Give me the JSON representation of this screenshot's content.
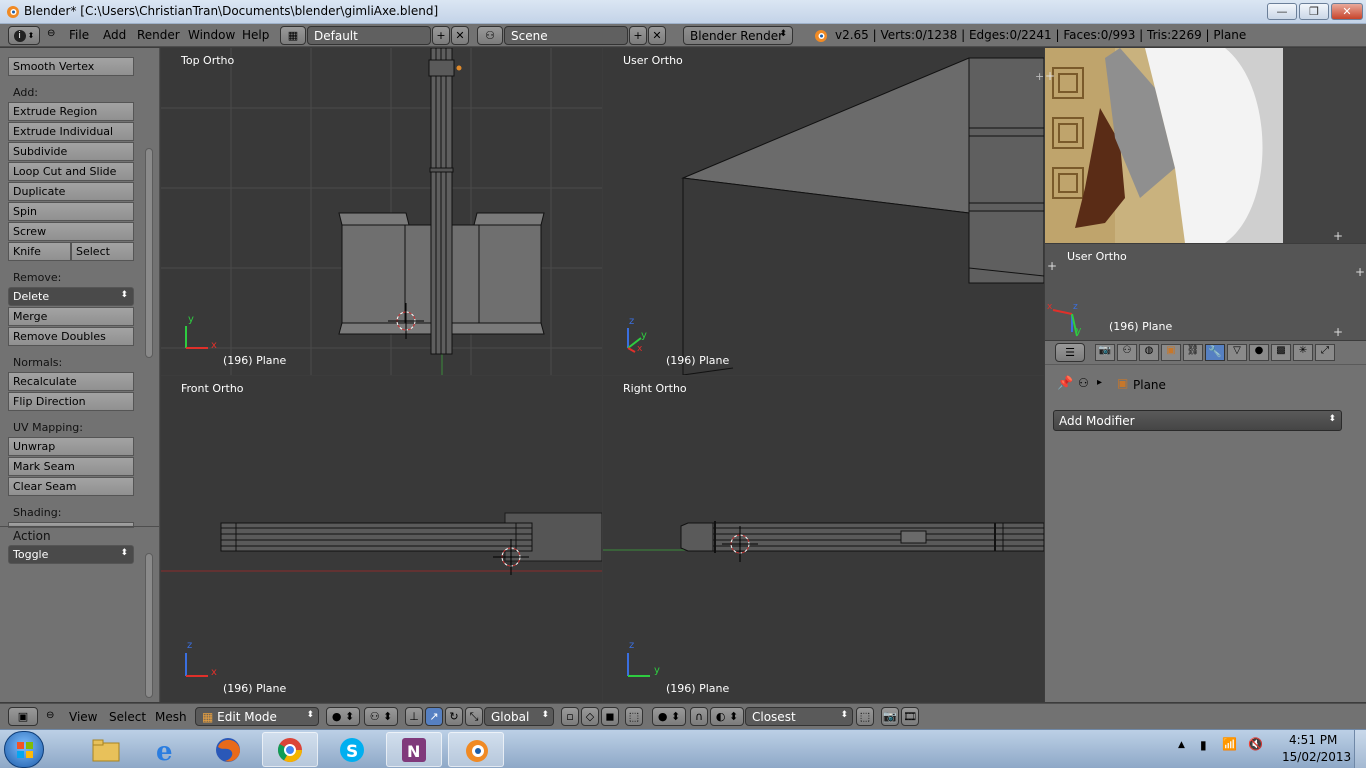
{
  "window": {
    "title": "Blender* [C:\\Users\\ChristianTran\\Documents\\blender\\gimliAxe.blend]",
    "minimize": "—",
    "maximize": "❐",
    "close": "✕"
  },
  "info_header": {
    "menus": [
      "File",
      "Add",
      "Render",
      "Window",
      "Help"
    ],
    "screen_layout": "Default",
    "scene": "Scene",
    "render_engine": "Blender Render",
    "stats": "v2.65 | Verts:0/1238 | Edges:0/2241 | Faces:0/993 | Tris:2269 | Plane"
  },
  "tool_shelf": {
    "top_button": "Smooth Vertex",
    "add_label": "Add:",
    "add_buttons": [
      "Extrude Region",
      "Extrude Individual",
      "Subdivide",
      "Loop Cut and Slide",
      "Duplicate",
      "Spin",
      "Screw"
    ],
    "knife": "Knife",
    "select": "Select",
    "remove_label": "Remove:",
    "delete": "Delete",
    "remove_buttons": [
      "Merge",
      "Remove Doubles"
    ],
    "normals_label": "Normals:",
    "normals_buttons": [
      "Recalculate",
      "Flip Direction"
    ],
    "uv_label": "UV Mapping:",
    "uv_buttons": [
      "Unwrap",
      "Mark Seam",
      "Clear Seam"
    ],
    "shading_label": "Shading:",
    "action_label": "Action",
    "action_value": "Toggle"
  },
  "viewports": {
    "top": {
      "label": "Top Ortho",
      "info": "(196) Plane",
      "axis_a": "y",
      "axis_b": "x"
    },
    "user": {
      "label": "User Ortho",
      "info": "(196) Plane",
      "axis_a": "z",
      "axis_b": "y",
      "axis_c": "x"
    },
    "front": {
      "label": "Front Ortho",
      "info": "(196) Plane",
      "axis_a": "z",
      "axis_b": "x"
    },
    "right": {
      "label": "Right Ortho",
      "info": "(196) Plane",
      "axis_a": "z",
      "axis_b": "y"
    },
    "mini": {
      "label": "User Ortho",
      "info": "(196) Plane",
      "axis_a": "z",
      "axis_b": "y",
      "axis_c": "x"
    }
  },
  "properties": {
    "object_name": "Plane",
    "add_modifier": "Add Modifier"
  },
  "view3d_header": {
    "menus": [
      "View",
      "Select",
      "Mesh"
    ],
    "mode": "Edit Mode",
    "orientation": "Global",
    "snap": "Closest"
  },
  "taskbar": {
    "time": "4:51 PM",
    "date": "15/02/2013"
  }
}
